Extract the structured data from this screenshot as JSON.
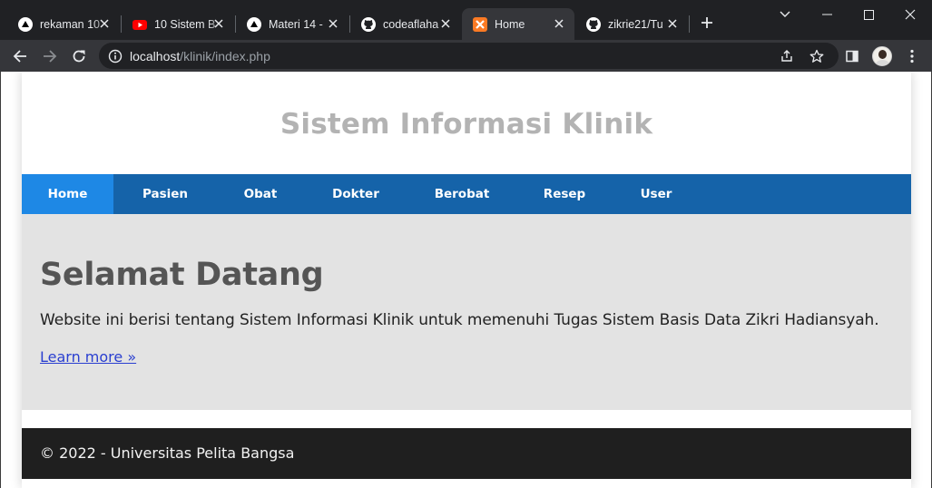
{
  "browser": {
    "tabs": [
      {
        "title": "rekaman 10",
        "icon": "vercel-triangle-icon"
      },
      {
        "title": "10 Sistem B",
        "icon": "youtube-icon"
      },
      {
        "title": "Materi 14 -",
        "icon": "vercel-triangle-icon"
      },
      {
        "title": "codeaflaha",
        "icon": "github-icon"
      },
      {
        "title": "Home",
        "icon": "xampp-icon",
        "active": true
      },
      {
        "title": "zikrie21/Tu",
        "icon": "github-icon"
      }
    ],
    "url_host": "localhost",
    "url_path": "/klinik/index.php"
  },
  "site": {
    "title": "Sistem Informasi Klinik",
    "nav": [
      "Home",
      "Pasien",
      "Obat",
      "Dokter",
      "Berobat",
      "Resep",
      "User"
    ],
    "active_nav": "Home",
    "hero": {
      "heading": "Selamat Datang",
      "text": "Website ini berisi tentang Sistem Informasi Klinik untuk memenuhi Tugas Sistem Basis Data Zikri Hadiansyah.",
      "link": "Learn more »"
    },
    "footer": "© 2022 - Universitas Pelita Bangsa"
  },
  "colors": {
    "nav_bg": "#1563a9",
    "nav_active": "#1e88e5",
    "hero_bg": "#e3e3e3",
    "footer_bg": "#1f1f1f",
    "title": "#b3b3b3"
  }
}
